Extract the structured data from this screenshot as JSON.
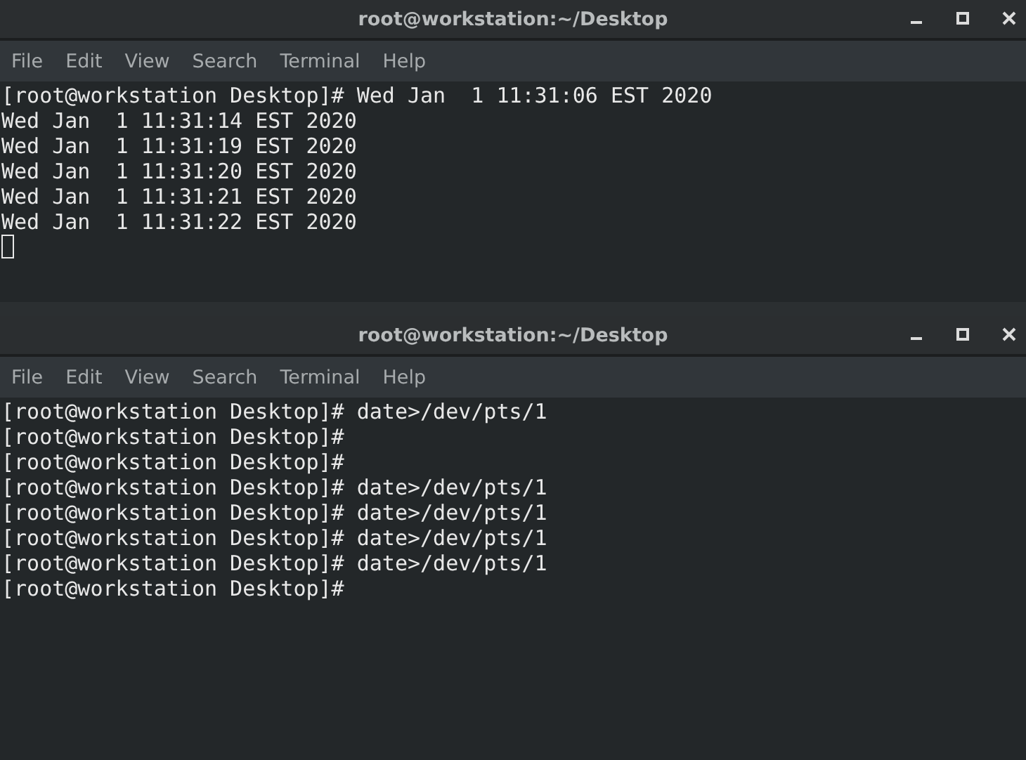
{
  "windows": [
    {
      "title": "root@workstation:~/Desktop",
      "menu": [
        "File",
        "Edit",
        "View",
        "Search",
        "Terminal",
        "Help"
      ],
      "lines": [
        "[root@workstation Desktop]# Wed Jan  1 11:31:06 EST 2020",
        "Wed Jan  1 11:31:14 EST 2020",
        "Wed Jan  1 11:31:19 EST 2020",
        "Wed Jan  1 11:31:20 EST 2020",
        "Wed Jan  1 11:31:21 EST 2020",
        "Wed Jan  1 11:31:22 EST 2020"
      ],
      "cursor": true
    },
    {
      "title": "root@workstation:~/Desktop",
      "menu": [
        "File",
        "Edit",
        "View",
        "Search",
        "Terminal",
        "Help"
      ],
      "lines": [
        "[root@workstation Desktop]# date>/dev/pts/1",
        "[root@workstation Desktop]#",
        "[root@workstation Desktop]#",
        "[root@workstation Desktop]# date>/dev/pts/1",
        "[root@workstation Desktop]# date>/dev/pts/1",
        "[root@workstation Desktop]# date>/dev/pts/1",
        "[root@workstation Desktop]# date>/dev/pts/1",
        "[root@workstation Desktop]#"
      ],
      "cursor": false
    }
  ]
}
